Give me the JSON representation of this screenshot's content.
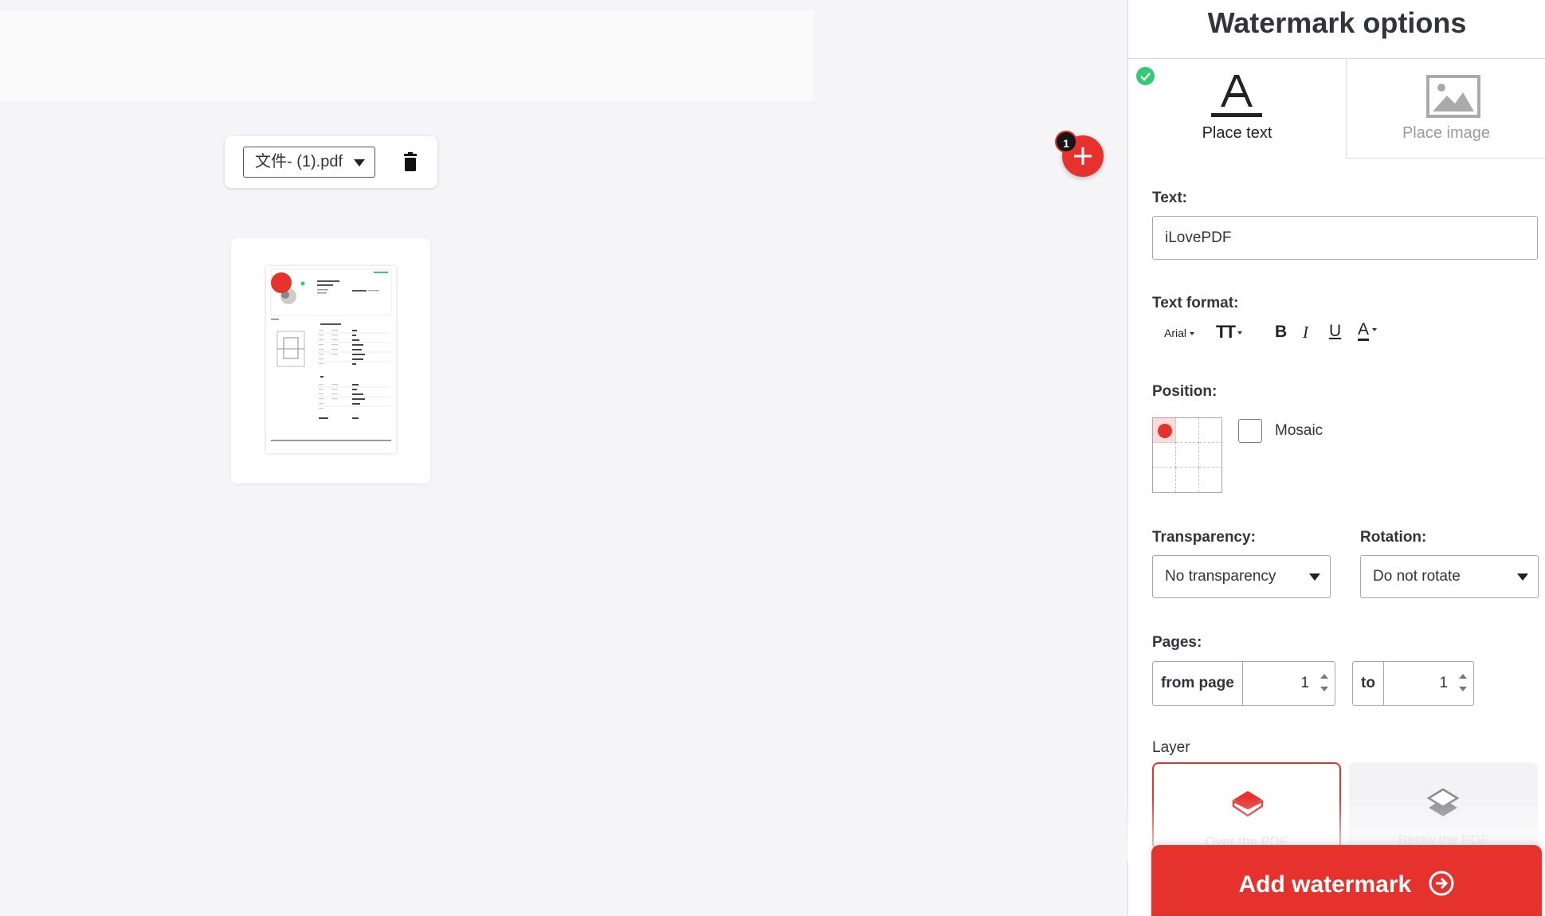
{
  "workspace": {
    "file": {
      "name": "文件- (1).pdf"
    },
    "add_files": {
      "badge_count": "1"
    }
  },
  "sidebar": {
    "title": "Watermark options",
    "tabs": [
      {
        "label": "Place text",
        "active": true
      },
      {
        "label": "Place image",
        "active": false
      }
    ],
    "text": {
      "label": "Text:",
      "value": "iLovePDF"
    },
    "text_format": {
      "label": "Text format:",
      "font": "Arial",
      "size_icon": "TT",
      "bold": "B",
      "italic": "I",
      "underline": "U",
      "color": "A"
    },
    "position": {
      "label": "Position:",
      "selected_cell": "top-left",
      "mosaic_label": "Mosaic",
      "mosaic_checked": false
    },
    "transparency": {
      "label": "Transparency:",
      "value": "No transparency"
    },
    "rotation": {
      "label": "Rotation:",
      "value": "Do not rotate"
    },
    "pages": {
      "label": "Pages:",
      "from_label": "from page",
      "from_value": "1",
      "to_label": "to",
      "to_value": "1"
    },
    "layer": {
      "label": "Layer",
      "options": [
        {
          "label": "Over the PDF",
          "selected": true
        },
        {
          "label": "Below the PDF",
          "selected": false
        }
      ]
    },
    "submit_label": "Add watermark"
  },
  "colors": {
    "accent": "#e5322d",
    "success": "#38c87a"
  }
}
